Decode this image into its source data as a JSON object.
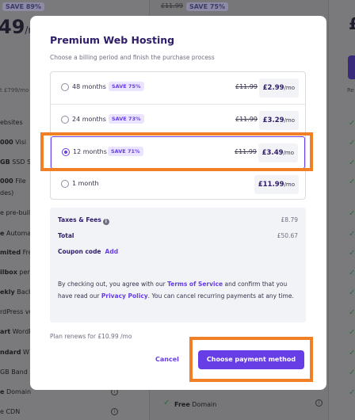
{
  "background": {
    "left": {
      "save_badge": "SAVE 89%",
      "price": "49",
      "price_suffix": "/mo",
      "strike_note": "t £799/mo",
      "features": [
        {
          "bold": "",
          "text": "ebsites"
        },
        {
          "bold": "000",
          "text": " Visi"
        },
        {
          "bold": "GB",
          "text": " SSD St"
        },
        {
          "bold": "000",
          "text": " File"
        },
        {
          "bold": "",
          "text": "des)"
        },
        {
          "bold": "",
          "text": "e pre-buil"
        },
        {
          "bold": "e",
          "text": " Automa"
        },
        {
          "bold": "mited",
          "text": " Fre"
        },
        {
          "bold": "ilbox",
          "text": " per"
        },
        {
          "bold": "ekly",
          "text": " Back"
        },
        {
          "bold": "",
          "text": "rdPress vu"
        },
        {
          "bold": "art",
          "text": " WordP"
        },
        {
          "bold": "ndard",
          "text": " W"
        },
        {
          "bold": "",
          "text": "GB Band"
        },
        {
          "bold": "e",
          "text": " Domain"
        },
        {
          "bold": "",
          "text": "e CDN"
        }
      ]
    },
    "middle": {
      "strike_price": "£11.99",
      "save_badge": "SAVE 75%",
      "free_domain_bold": "Free",
      "free_domain_text": " Domain"
    },
    "right": {
      "price_fragment": "£",
      "small_text": "Re"
    }
  },
  "modal": {
    "title": "Premium Web Hosting",
    "subtitle": "Choose a billing period and finish the purchase process",
    "plans": [
      {
        "label": "48 months",
        "badge": "SAVE 75%",
        "old_price": "£11.99",
        "price": "£2.99",
        "per": "/mo",
        "selected": false
      },
      {
        "label": "24 months",
        "badge": "SAVE 73%",
        "old_price": "£11.99",
        "price": "£3.29",
        "per": "/mo",
        "selected": false
      },
      {
        "label": "12 months",
        "badge": "SAVE 71%",
        "old_price": "£11.99",
        "price": "£3.49",
        "per": "/mo",
        "selected": true
      },
      {
        "label": "1 month",
        "badge": "",
        "old_price": "",
        "price": "£11.99",
        "per": "/mo",
        "selected": false
      }
    ],
    "summary": {
      "taxes_label": "Taxes & Fees",
      "taxes_value": "£8.79",
      "total_label": "Total",
      "total_value": "£50.67",
      "coupon_label": "Coupon code",
      "coupon_link": "Add",
      "terms_1": "By checking out, you agree with our ",
      "terms_link": "Terms of Service",
      "terms_2": " and confirm that you have read our ",
      "privacy_link": "Privacy Policy",
      "terms_3": ". You can cancel recurring payments at any time."
    },
    "renew_note": "Plan renews for £10.99 /mo",
    "cancel_label": "Cancel",
    "pay_label": "Choose payment method"
  },
  "colors": {
    "accent": "#673de6",
    "title": "#2f1c6a",
    "highlight": "#f07f26"
  }
}
